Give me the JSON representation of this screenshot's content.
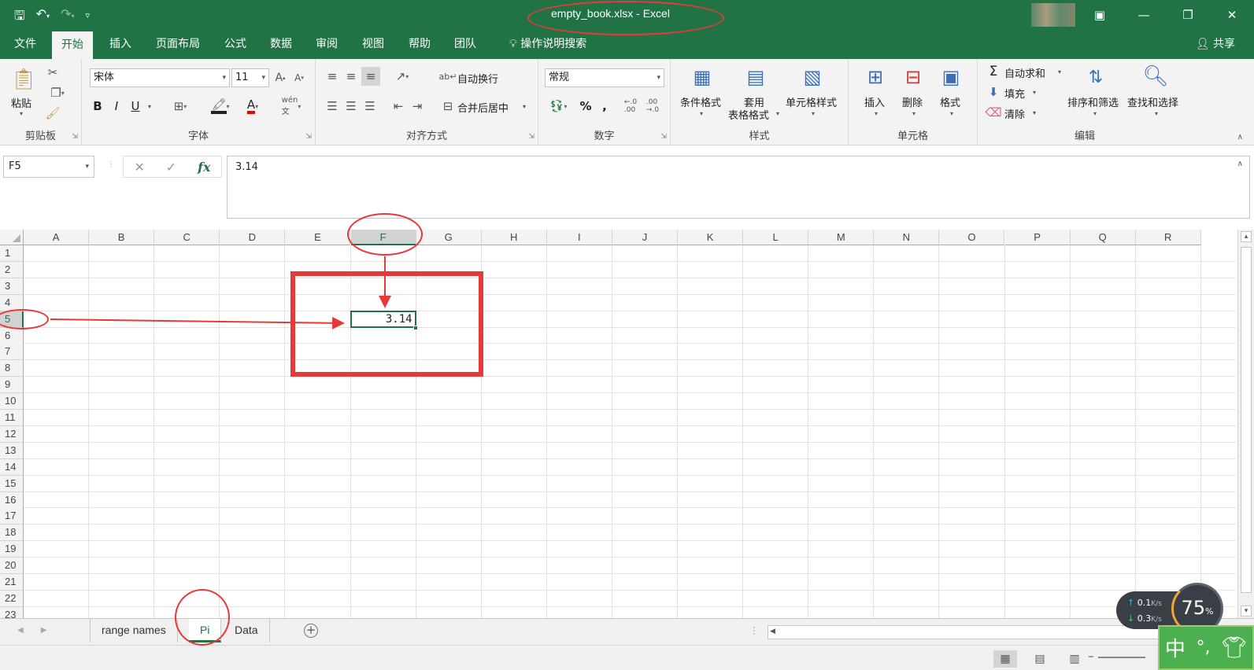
{
  "window": {
    "title": "empty_book.xlsx  -  Excel",
    "accent_color": "#217346",
    "annotation_color": "#e8393a"
  },
  "quick_access": {
    "save_icon": "save-icon",
    "undo_icon": "undo-icon",
    "redo_icon": "redo-icon",
    "customize_icon": "customize-qat-icon"
  },
  "ribbon_tabs": [
    "文件",
    "开始",
    "插入",
    "页面布局",
    "公式",
    "数据",
    "审阅",
    "视图",
    "帮助",
    "团队"
  ],
  "active_tab": "开始",
  "tell_me": "操作说明搜索",
  "share": "共享",
  "ribbon": {
    "clipboard": {
      "label": "剪贴板",
      "paste": "粘贴"
    },
    "font": {
      "label": "字体",
      "font_name": "宋体",
      "font_size": "11",
      "bold": "B",
      "italic": "I",
      "underline": "U"
    },
    "alignment": {
      "label": "对齐方式",
      "wrap_text": "自动换行",
      "merge_center": "合并后居中"
    },
    "number": {
      "label": "数字",
      "format": "常规",
      "percent": "%",
      "comma": ","
    },
    "styles": {
      "label": "样式",
      "conditional": "条件格式",
      "table_format_1": "套用",
      "table_format_2": "表格格式",
      "cell_styles": "单元格样式"
    },
    "cells": {
      "label": "单元格",
      "insert": "插入",
      "delete": "删除",
      "format": "格式"
    },
    "editing": {
      "label": "编辑",
      "autosum": "自动求和",
      "fill": "填充",
      "clear": "清除",
      "sort_filter": "排序和筛选",
      "find_select": "查找和选择"
    }
  },
  "formula_bar": {
    "name_box": "F5",
    "formula": "3.14"
  },
  "grid": {
    "columns": [
      "A",
      "B",
      "C",
      "D",
      "E",
      "F",
      "G",
      "H",
      "I",
      "J",
      "K",
      "L",
      "M",
      "N",
      "O",
      "P",
      "Q",
      "R"
    ],
    "rows": [
      "1",
      "2",
      "3",
      "4",
      "5",
      "6",
      "7",
      "8",
      "9",
      "10",
      "11",
      "12",
      "13",
      "14",
      "15",
      "16",
      "17",
      "18",
      "19",
      "20",
      "21",
      "22",
      "23"
    ],
    "active_cell": {
      "ref": "F5",
      "value": "3.14"
    }
  },
  "sheets": [
    "range names",
    "Pi",
    "Data"
  ],
  "active_sheet": "Pi",
  "net_monitor": {
    "upload": "0.1",
    "download": "0.3",
    "unit": "K/s",
    "gauge": "75",
    "gauge_unit": "%"
  },
  "ime": {
    "mode": "中",
    "punct": "°,"
  }
}
